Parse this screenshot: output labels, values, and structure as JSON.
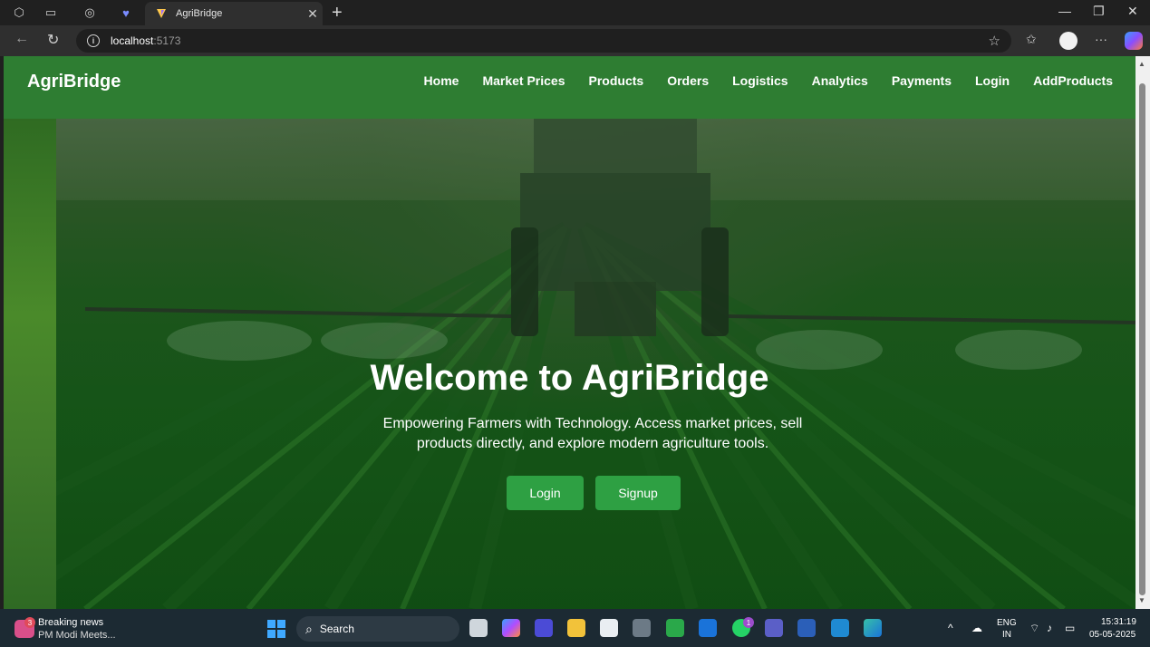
{
  "browser": {
    "tab_title": "AgriBridge",
    "url_host": "localhost",
    "url_port": ":5173"
  },
  "site": {
    "brand": "AgriBridge",
    "nav": [
      "Home",
      "Market Prices",
      "Products",
      "Orders",
      "Logistics",
      "Analytics",
      "Payments",
      "Login",
      "AddProducts"
    ],
    "hero_title": "Welcome to AgriBridge",
    "hero_subtitle": "Empowering Farmers with Technology. Access market prices, sell products directly, and explore modern agriculture tools.",
    "login_button": "Login",
    "signup_button": "Signup",
    "colors": {
      "header": "#2e7d32",
      "button": "#2ea043"
    }
  },
  "taskbar": {
    "news_badge": "3",
    "news_title": "Breaking news",
    "news_sub": "PM Modi Meets...",
    "search_label": "Search",
    "lang_top": "ENG",
    "lang_bottom": "IN",
    "time": "15:31:19",
    "date": "05-05-2025",
    "badge_whatsapp": "1"
  }
}
